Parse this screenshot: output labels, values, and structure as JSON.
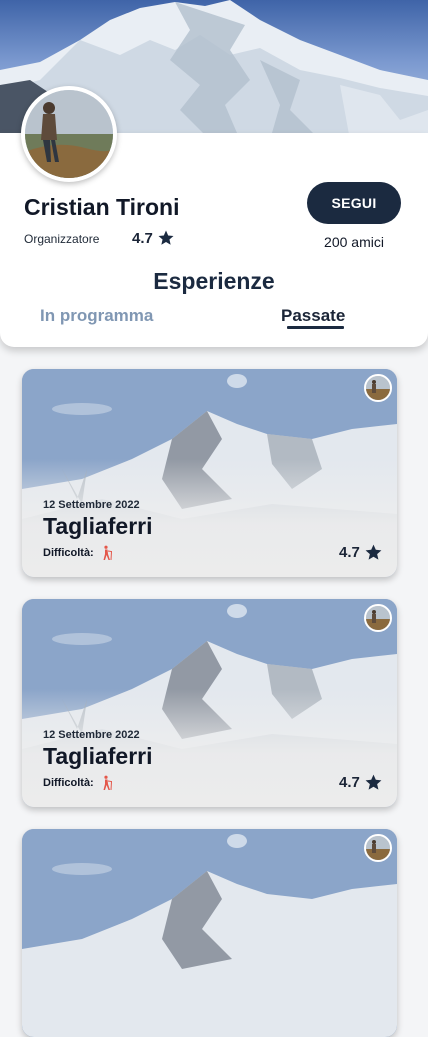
{
  "profile": {
    "name": "Cristian Tironi",
    "role": "Organizzatore",
    "rating": "4.7",
    "follow_label": "SEGUI",
    "friends": "200 amici"
  },
  "experiences": {
    "title": "Esperienze",
    "tabs": [
      {
        "label": "In programma",
        "active": false
      },
      {
        "label": "Passate",
        "active": true
      }
    ],
    "cards": [
      {
        "date": "12 Settembre 2022",
        "title": "Tagliaferri",
        "difficulty_label": "Difficoltà:",
        "rating": "4.7"
      },
      {
        "date": "12 Settembre 2022",
        "title": "Tagliaferri",
        "difficulty_label": "Difficoltà:",
        "rating": "4.7"
      },
      {
        "date": "",
        "title": "",
        "difficulty_label": "",
        "rating": ""
      }
    ]
  },
  "colors": {
    "primary": "#1b2a40",
    "tab_inactive": "#8097b3",
    "difficulty_icon": "#e4574a"
  },
  "icons": {
    "star": "star-icon",
    "difficulty": "hiker-icon"
  }
}
